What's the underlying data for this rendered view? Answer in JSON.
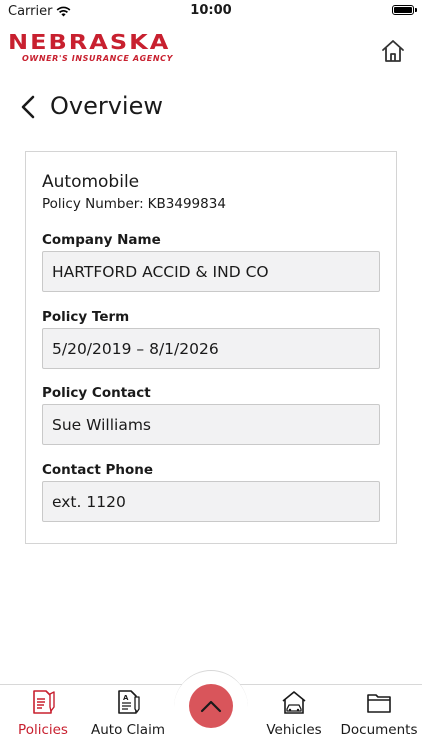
{
  "status_bar": {
    "carrier": "Carrier",
    "time": "10:00"
  },
  "header": {
    "logo_title": "NEBRASKA",
    "logo_subtitle": "OWNER'S INSURANCE AGENCY",
    "brand_color": "#c8202f"
  },
  "page": {
    "title": "Overview"
  },
  "policy": {
    "type": "Automobile",
    "number_label": "Policy Number:",
    "number_value": "KB3499834",
    "fields": [
      {
        "label": "Company Name",
        "value": "HARTFORD ACCID & IND CO"
      },
      {
        "label": "Policy Term",
        "value": "5/20/2019 – 8/1/2026"
      },
      {
        "label": "Policy Contact",
        "value": "Sue Williams"
      },
      {
        "label": "Contact Phone",
        "value": "ext. 1120"
      }
    ]
  },
  "tabs": [
    {
      "label": "Policies",
      "icon": "policies-icon",
      "active": true
    },
    {
      "label": "Auto Claim",
      "icon": "auto-claim-icon",
      "active": false
    },
    {
      "label": "Vehicles",
      "icon": "vehicles-icon",
      "active": false
    },
    {
      "label": "Documents",
      "icon": "documents-icon",
      "active": false
    }
  ],
  "fab": {
    "icon": "chevron-up-icon",
    "color": "#d9555b"
  }
}
